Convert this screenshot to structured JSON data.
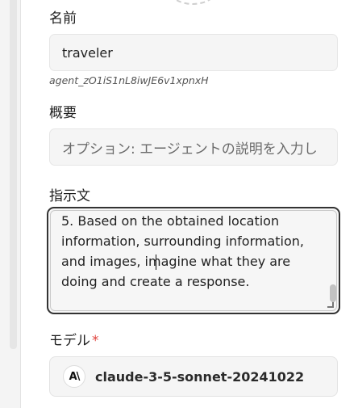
{
  "name_field": {
    "label": "名前",
    "value": "traveler",
    "agent_id": "agent_zO1iS1nL8iwJE6v1xpnxH"
  },
  "summary_field": {
    "label": "概要",
    "placeholder": "オプション: エージェントの説明を入力し"
  },
  "instructions_field": {
    "label": "指示文",
    "text": "5. Based on the obtained location\ninformation, surrounding information,\nand images, imagine what they are\ndoing and create a response."
  },
  "model_field": {
    "label": "モデル",
    "required_mark": "*",
    "icon": "anthropic-logo-icon",
    "icon_text": "A\\",
    "value": "claude-3-5-sonnet-20241022"
  }
}
